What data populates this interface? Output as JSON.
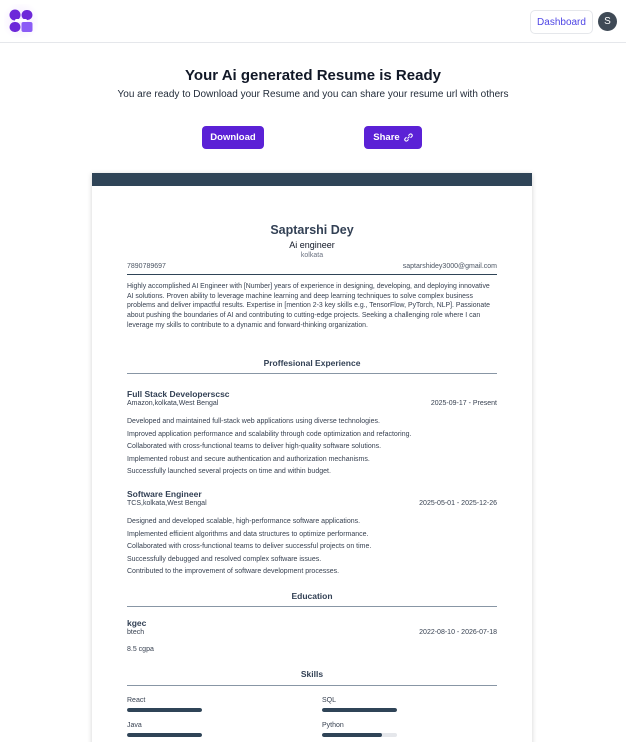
{
  "nav": {
    "dashboard_label": "Dashboard",
    "avatar_initial": "S"
  },
  "header": {
    "title": "Your Ai generated Resume is Ready",
    "subtitle": "You are ready to Download your Resume and you can share your resume url with others",
    "download_label": "Download",
    "share_label": "Share"
  },
  "resume": {
    "name": "Saptarshi Dey",
    "job_title": "Ai engineer",
    "location": "kolkata",
    "phone": "7890789697",
    "email": "saptarshidey3000@gmail.com",
    "summary": "Highly accomplished AI Engineer with [Number] years of experience in designing, developing, and deploying innovative AI solutions. Proven ability to leverage machine learning and deep learning techniques to solve complex business problems and deliver impactful results. Expertise in [mention 2-3 key skills e.g., TensorFlow, PyTorch, NLP]. Passionate about pushing the boundaries of AI and contributing to cutting-edge projects. Seeking a challenging role where I can leverage my skills to contribute to a dynamic and forward-thinking organization.",
    "experience_title": "Proffesional Experience",
    "experience": [
      {
        "title": "Full Stack Developerscsc",
        "company": "Amazon,kolkata,West Bengal",
        "dates": "2025-09-17 - Present",
        "bullets": [
          "Developed and maintained full-stack web applications using diverse technologies.",
          "Improved application performance and scalability through code optimization and refactoring.",
          "Collaborated with cross-functional teams to deliver high-quality software solutions.",
          "Implemented robust and secure authentication and authorization mechanisms.",
          "Successfully launched several projects on time and within budget."
        ]
      },
      {
        "title": "Software Engineer",
        "company": "TCS,kolkata,West Bengal",
        "dates": "2025-05-01 - 2025-12-26",
        "bullets": [
          "Designed and developed scalable, high-performance software applications.",
          "Implemented efficient algorithms and data structures to optimize performance.",
          "Collaborated with cross-functional teams to deliver successful projects on time.",
          "Successfully debugged and resolved complex software issues.",
          "Contributed to the improvement of software development processes."
        ]
      }
    ],
    "education_title": "Education",
    "education": {
      "school": "kgec",
      "degree": "btech",
      "dates": "2022-08-10 - 2026-07-18",
      "grade": "8.5 cgpa"
    },
    "skills_title": "Skills",
    "skills": [
      {
        "name": "React",
        "level": 1.0
      },
      {
        "name": "SQL",
        "level": 1.0
      },
      {
        "name": "Java",
        "level": 1.0
      },
      {
        "name": "Python",
        "level": 0.8
      }
    ]
  },
  "colors": {
    "accent": "#5b21d6",
    "resume_header": "#2f4457"
  }
}
